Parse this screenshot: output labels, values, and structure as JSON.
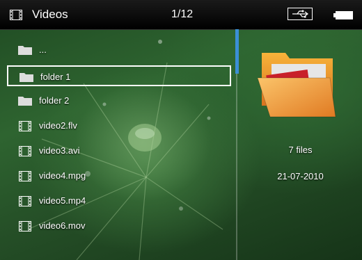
{
  "header": {
    "title": "Videos",
    "counter": "1/12"
  },
  "files": [
    {
      "label": "...",
      "icon": "folder-icon",
      "selected": false
    },
    {
      "label": "folder 1",
      "icon": "folder-icon",
      "selected": true
    },
    {
      "label": "folder 2",
      "icon": "folder-icon",
      "selected": false
    },
    {
      "label": "video2.flv",
      "icon": "film-icon",
      "selected": false
    },
    {
      "label": "video3.avi",
      "icon": "film-icon",
      "selected": false
    },
    {
      "label": "video4.mpg",
      "icon": "film-icon",
      "selected": false
    },
    {
      "label": "video5.mp4",
      "icon": "film-icon",
      "selected": false
    },
    {
      "label": "video6.mov",
      "icon": "film-icon",
      "selected": false
    }
  ],
  "details": {
    "count": "7 files",
    "date": "21-07-2010"
  },
  "colors": {
    "accent": "#3b8fd6",
    "folder": "#f0a030"
  }
}
